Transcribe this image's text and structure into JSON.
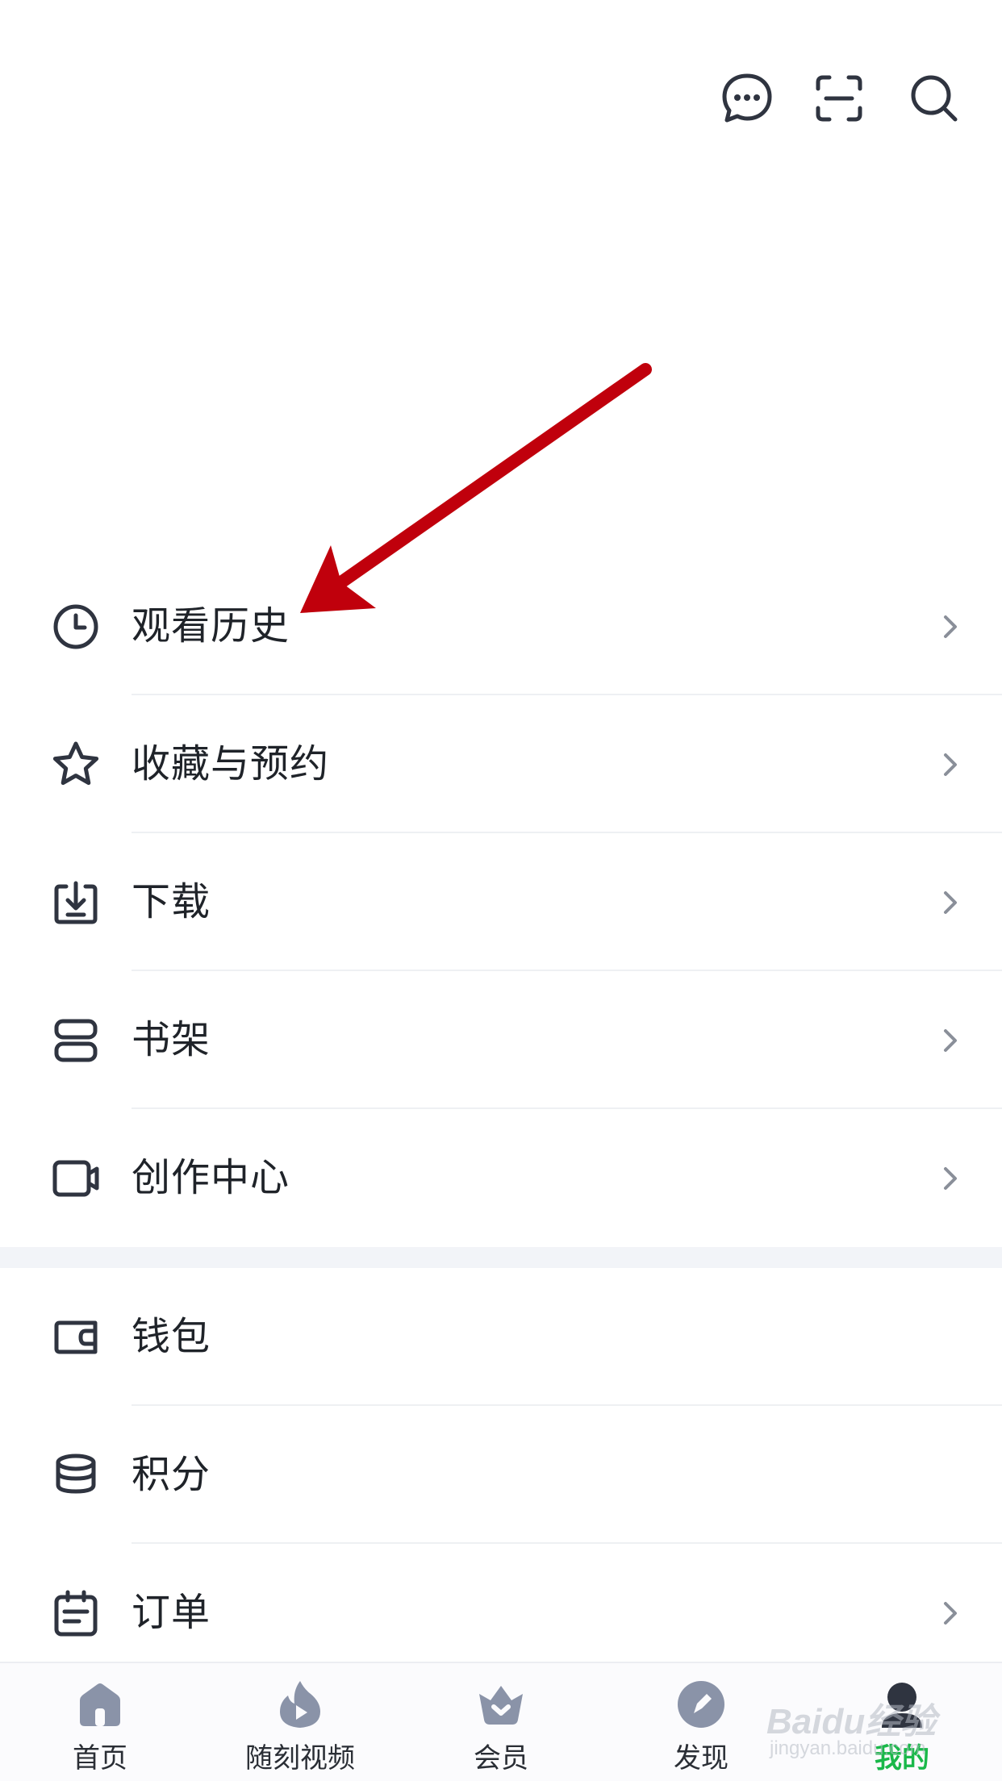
{
  "header": {
    "icons": [
      "message-icon",
      "scan-icon",
      "search-icon"
    ]
  },
  "menu_group_1": [
    {
      "label": "观看历史",
      "icon": "clock-icon",
      "chevron": true
    },
    {
      "label": "收藏与预约",
      "icon": "star-icon",
      "chevron": true
    },
    {
      "label": "下载",
      "icon": "download-icon",
      "chevron": true
    },
    {
      "label": "书架",
      "icon": "bookshelf-icon",
      "chevron": true
    },
    {
      "label": "创作中心",
      "icon": "video-camera-icon",
      "chevron": true
    }
  ],
  "menu_group_2": [
    {
      "label": "钱包",
      "icon": "wallet-icon",
      "chevron": false
    },
    {
      "label": "积分",
      "icon": "coins-icon",
      "chevron": false
    },
    {
      "label": "订单",
      "icon": "calendar-icon",
      "chevron": true
    }
  ],
  "tab_bar": {
    "tabs": [
      {
        "label": "首页",
        "icon": "home-icon",
        "active": false
      },
      {
        "label": "随刻视频",
        "icon": "flame-play-icon",
        "active": false
      },
      {
        "label": "会员",
        "icon": "crown-icon",
        "active": false
      },
      {
        "label": "发现",
        "icon": "compass-icon",
        "active": false
      },
      {
        "label": "我的",
        "icon": "profile-icon",
        "active": true
      }
    ]
  },
  "watermark": {
    "main": "Baidu经验",
    "sub": "jingyan.baidu.com"
  },
  "colors": {
    "active_tab": "#1ab84a",
    "icon_dark": "#2f3440",
    "tab_icon": "#8a93a8",
    "annotation_arrow": "#c0000c",
    "section_gap": "#f2f4f8"
  }
}
